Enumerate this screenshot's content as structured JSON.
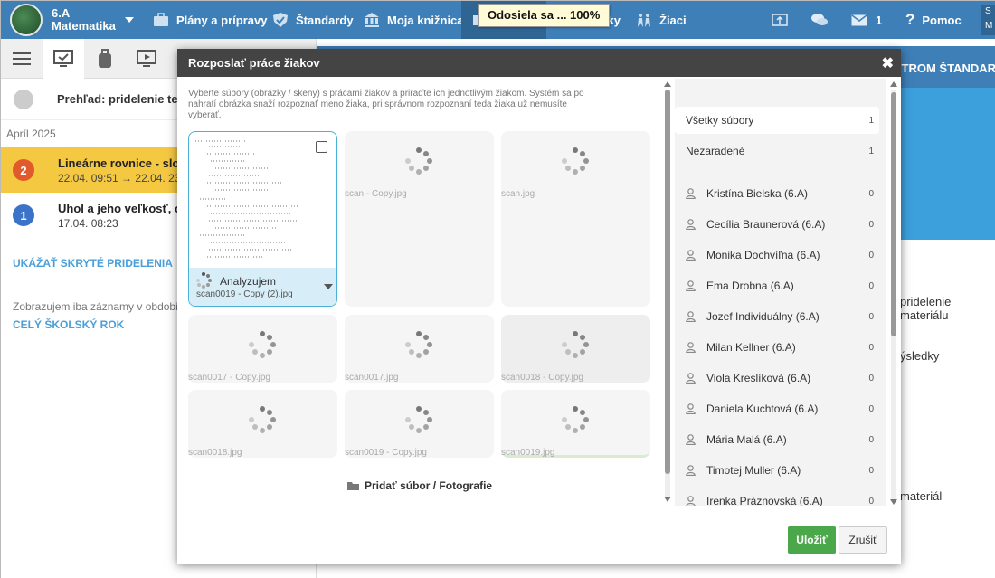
{
  "topbar": {
    "class_name": "6.A",
    "subject": "Matematika",
    "nav": [
      {
        "label": "Plány a prípravy",
        "icon": "briefcase-icon"
      },
      {
        "label": "Štandardy",
        "icon": "shield-check-icon"
      },
      {
        "label": "Moja knižnica",
        "icon": "library-icon"
      },
      {
        "label": "mky",
        "icon": "results-icon"
      },
      {
        "label": "Žiaci",
        "icon": "students-icon"
      }
    ],
    "messages_count": "1",
    "help_label": "Pomoc",
    "user_initials": "S",
    "user_sub": "M"
  },
  "tooltip": {
    "text": "Odosiela sa ... 100%"
  },
  "left": {
    "overview_title": "Prehľad: pridelenie test",
    "month": "Apríl 2025",
    "assignments": [
      {
        "num": "2",
        "title": "Lineárne rovnice - slov",
        "dates": "22.04. 09:51 → 22.04. 23",
        "color": "#e05a2b"
      },
      {
        "num": "1",
        "title": "Uhol a jeho veľkosť, op",
        "dates": "17.04. 08:23",
        "color": "#3a73c9"
      }
    ],
    "show_hidden": "UKÁŽAŤ SKRYTÉ PRIDELENIA",
    "info": "Zobrazujem iba záznamy v obdobi",
    "school_year": "CELÝ ŠKOLSKÝ ROK"
  },
  "right_bg": {
    "strom": "STROM ŠTANDAR",
    "line1": "pridelenie materiálu",
    "line2": "ýsledky",
    "line3": "materiál"
  },
  "modal": {
    "title": "Rozposlať práce žiakov",
    "instructions": "Vyberte súbory (obrázky / skeny) s prácami žiakov a priraďte ich jednotlivým žiakom. Systém sa po nahratí obrázka snaží rozpoznať meno žiaka, pri správnom rozpoznaní teda žiaka už nemusíte vyberať.",
    "first_file": {
      "status": "Analyzujem",
      "name": "scan0019 - Copy (2).jpg"
    },
    "files": [
      "scan - Copy.jpg",
      "scan.jpg",
      "scan0017 - Copy.jpg",
      "scan0017.jpg",
      "scan0018 - Copy.jpg",
      "scan0018.jpg",
      "scan0019 - Copy.jpg",
      "scan0019.jpg"
    ],
    "add_file": "Pridať súbor / Fotografie",
    "filters": [
      {
        "label": "Všetky súbory",
        "count": "1"
      },
      {
        "label": "Nezaradené",
        "count": "1"
      }
    ],
    "students": [
      {
        "name": "Kristína Bielska (6.A)",
        "count": "0"
      },
      {
        "name": "Cecília Braunerová (6.A)",
        "count": "0"
      },
      {
        "name": "Monika Dochvíľna (6.A)",
        "count": "0"
      },
      {
        "name": "Ema Drobna (6.A)",
        "count": "0"
      },
      {
        "name": "Jozef Individuálny (6.A)",
        "count": "0"
      },
      {
        "name": "Milan Kellner (6.A)",
        "count": "0"
      },
      {
        "name": "Viola Kreslíková (6.A)",
        "count": "0"
      },
      {
        "name": "Daniela Kuchtová (6.A)",
        "count": "0"
      },
      {
        "name": "Mária Malá (6.A)",
        "count": "0"
      },
      {
        "name": "Timotej Muller (6.A)",
        "count": "0"
      },
      {
        "name": "Irenka Práznovská (6.A)",
        "count": "0"
      }
    ],
    "save": "Uložiť",
    "cancel": "Zrušiť"
  }
}
